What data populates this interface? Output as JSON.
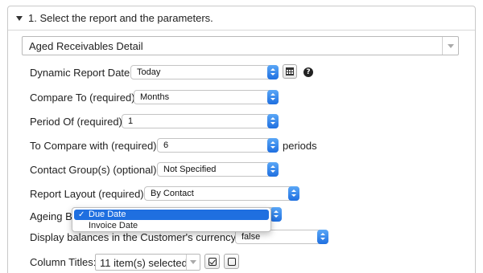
{
  "section": {
    "title": "1. Select the report and the parameters."
  },
  "report_select": {
    "value": "Aged Receivables Detail"
  },
  "rows": {
    "dynamic_date": {
      "label": "Dynamic Report Date:",
      "value": "Today"
    },
    "compare_to": {
      "label": "Compare To (required)",
      "value": "Months"
    },
    "period_of": {
      "label": "Period Of (required)",
      "value": "1"
    },
    "to_compare_with": {
      "label": "To Compare with (required)",
      "value": "6",
      "suffix": "periods"
    },
    "contact_group": {
      "label": "Contact Group(s) (optional)",
      "value": "Not Specified"
    },
    "report_layout": {
      "label": "Report Layout (required)",
      "value": "By Contact"
    },
    "ageing_by": {
      "label": "Ageing By",
      "options": [
        "Due Date",
        "Invoice Date"
      ],
      "selected": "Due Date"
    },
    "display_currency": {
      "label": "Display balances in the Customer's currency:",
      "value": "false"
    },
    "column_titles": {
      "label": "Column Titles:",
      "value": "11 item(s) selected"
    }
  },
  "icons": {
    "calendar": "calendar-icon",
    "help": "help-icon",
    "select_all": "check-all-icon",
    "deselect_all": "uncheck-all-icon"
  },
  "colors": {
    "accent": "#1f6fe0"
  }
}
